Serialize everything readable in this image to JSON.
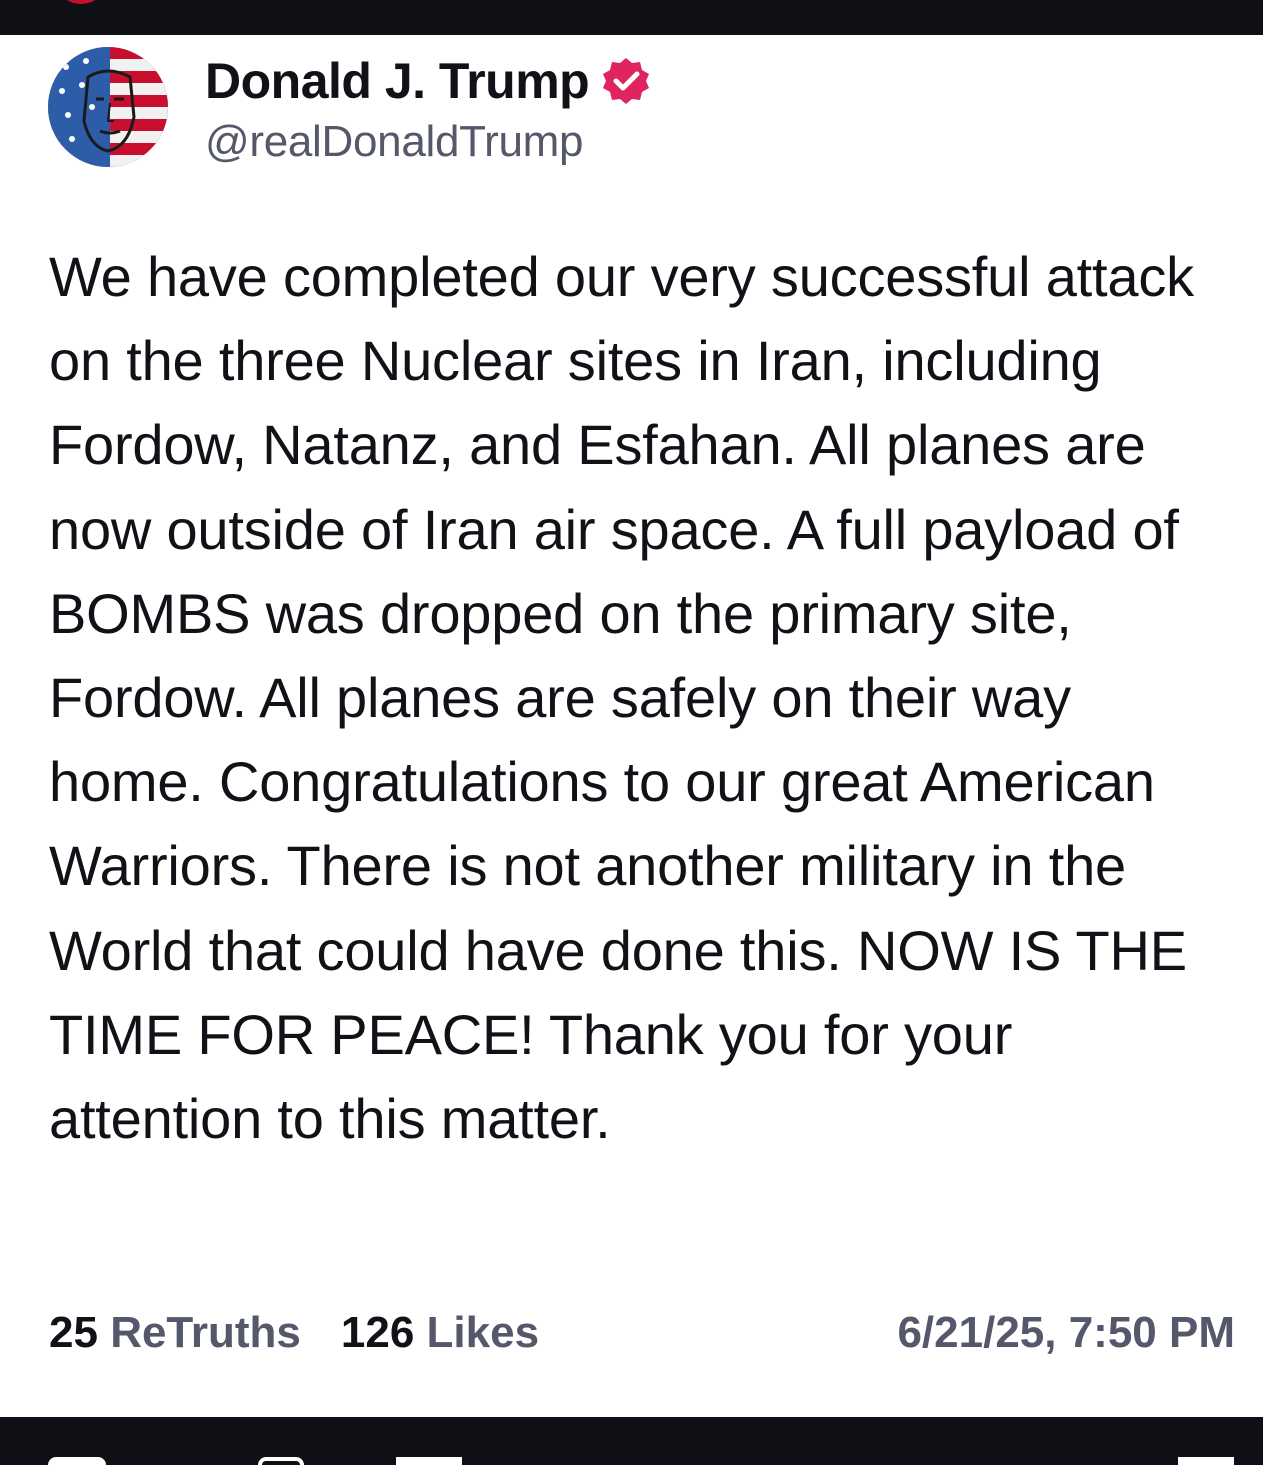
{
  "author": {
    "display_name": "Donald J. Trump",
    "handle": "@realDonaldTrump",
    "verified": true,
    "verified_badge_color": "#e0245e"
  },
  "post": {
    "text": "We have completed our very successful attack on the three Nuclear sites in Iran, including Fordow, Natanz, and Esfahan. All planes are now outside of Iran air space. A full payload of BOMBS was dropped on the primary site, Fordow. All planes are safely on their way home. Congratulations to our great American Warriors. There is not another military in the World that could have done this. NOW IS THE TIME FOR PEACE! Thank you for your attention to this matter.",
    "retruths_count": "25",
    "retruths_label": "ReTruths",
    "likes_count": "126",
    "likes_label": "Likes",
    "timestamp": "6/21/25, 7:50 PM"
  },
  "icons": {
    "avatar": "avatar-image",
    "verified": "verified-badge-icon",
    "bottom_nav": [
      "home-icon",
      "search-icon",
      "feed-icon",
      "menu-icon"
    ]
  },
  "colors": {
    "text_primary": "#111117",
    "text_secondary": "#55576a",
    "chrome": "#0e1016",
    "accent": "#e0245e"
  }
}
